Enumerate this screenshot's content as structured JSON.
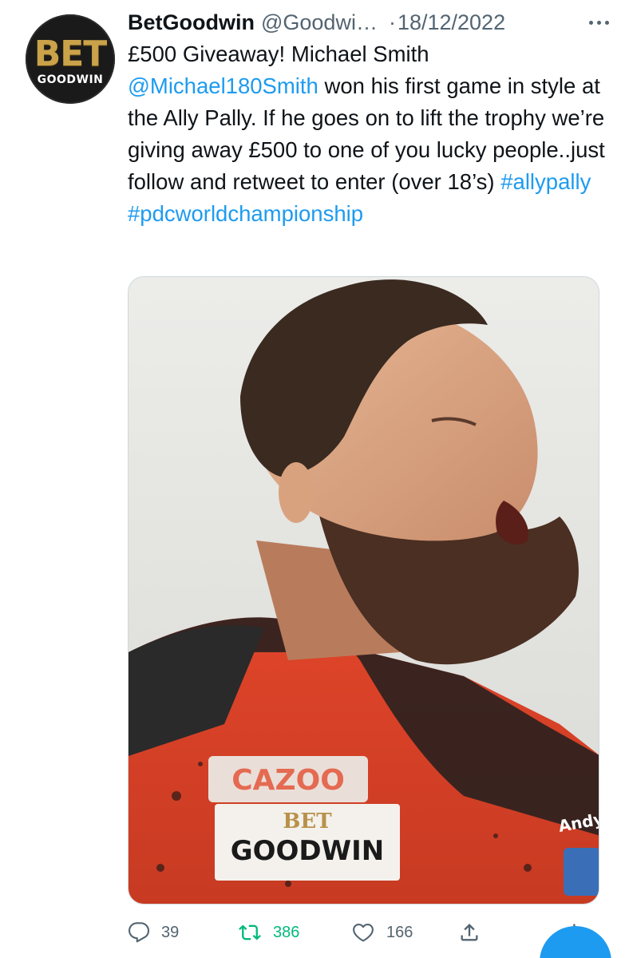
{
  "tweet": {
    "author": {
      "display_name": "BetGoodwin",
      "handle": "@Goodwi…",
      "avatar_text_top": "BET",
      "avatar_text_bottom": "GOODWIN"
    },
    "separator": "·",
    "date": "18/12/2022",
    "text": {
      "part1": "£500 Giveaway! Michael Smith ",
      "mention": "@Michael180Smith",
      "part2": " won his first game in style at the Ally Pally. If he goes on to lift the trophy we’re giving away £500 to one of you lucky people..just follow and retweet to enter (over 18’s) ",
      "hashtag1": "#allypally",
      "hashtag2": "#pdcworldchampionship"
    },
    "media": {
      "shirt_sponsor_top": "CAZOO",
      "shirt_sponsor_bet": "BET",
      "shirt_sponsor_goodwin": "GOODWIN",
      "shirt_badge": "Andy"
    },
    "actions": {
      "replies": "39",
      "retweets": "386",
      "likes": "166"
    },
    "colors": {
      "link": "#1d9bf0",
      "retweet": "#00ba7c",
      "muted": "#536471"
    },
    "icons": [
      "reply-icon",
      "retweet-icon",
      "like-icon",
      "share-icon",
      "analytics-icon",
      "more-icon"
    ]
  }
}
